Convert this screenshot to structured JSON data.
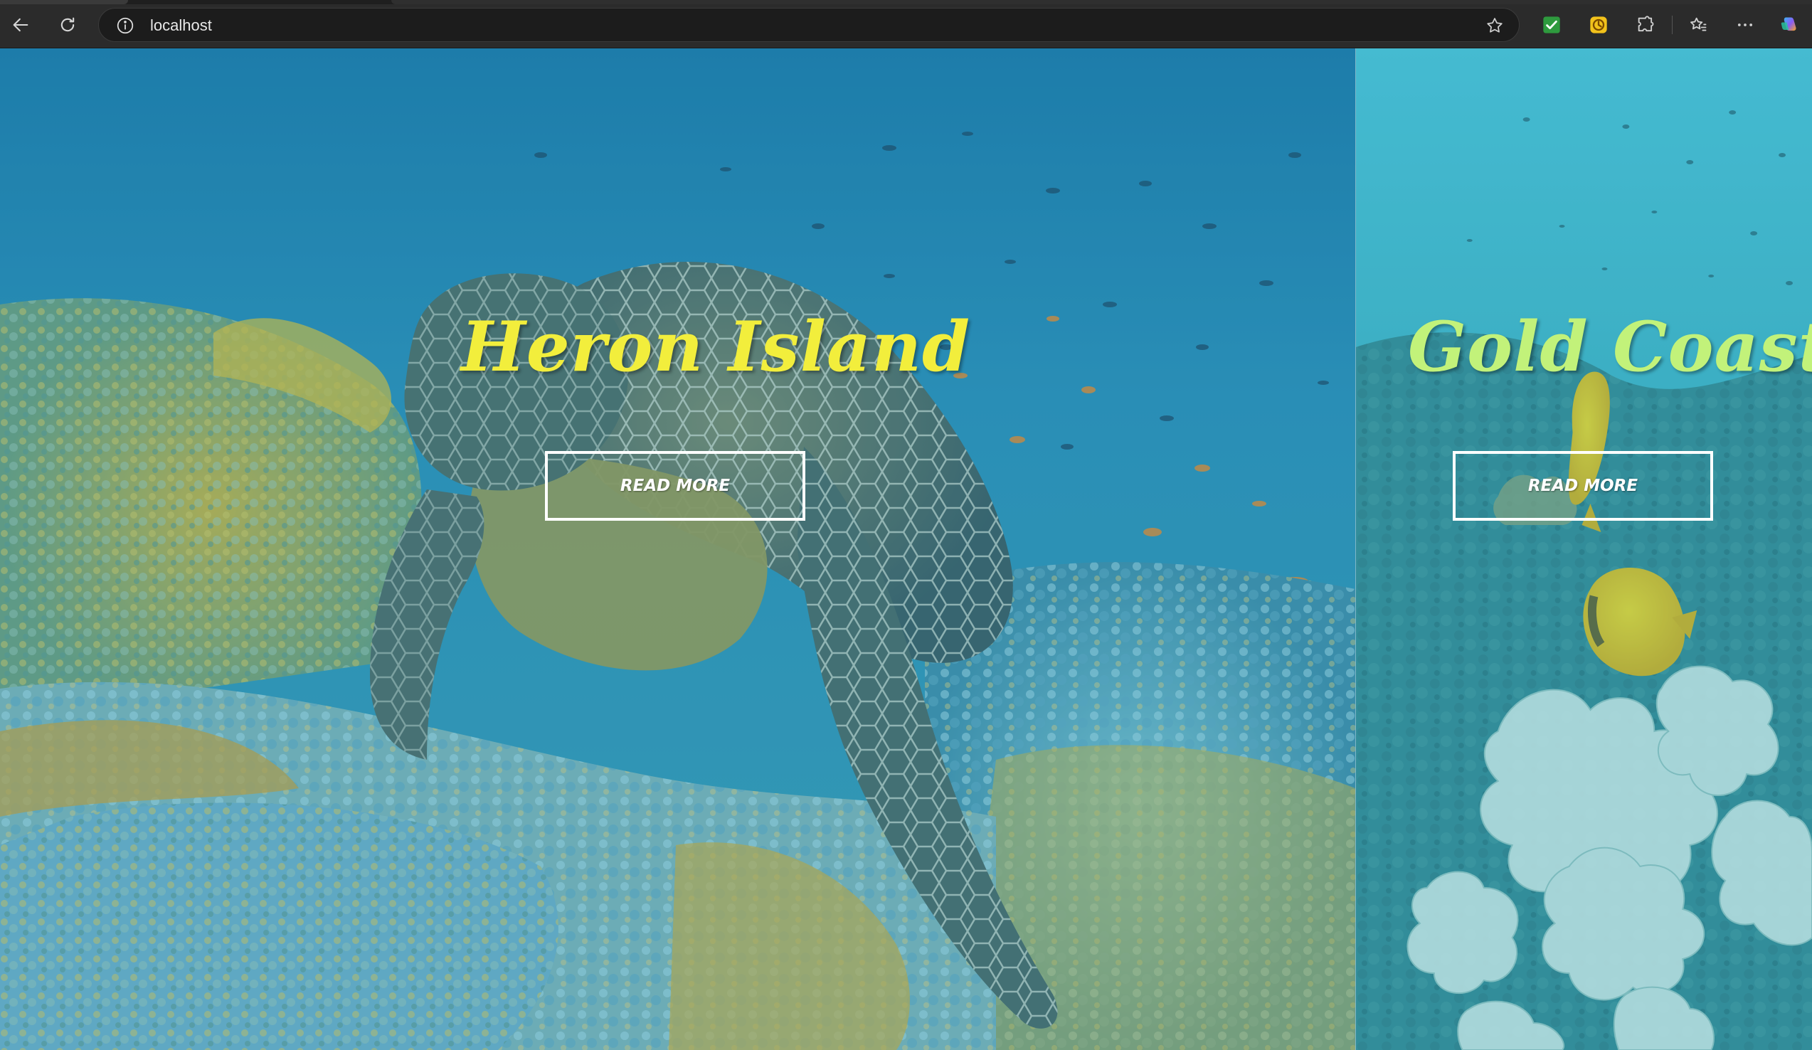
{
  "browser": {
    "url": "localhost",
    "icons": {
      "back": "back-arrow-icon",
      "reload": "reload-icon",
      "site_info": "info-icon",
      "bookmark": "star-icon",
      "extension_1": "checkmark-extension-icon",
      "extension_2": "coin-extension-icon",
      "extensions": "puzzle-icon",
      "favorites": "favorites-icon",
      "menu": "more-icon",
      "copilot": "copilot-icon"
    }
  },
  "panels": [
    {
      "title": "Heron Island",
      "button_label": "READ MORE",
      "title_color": "#f2ee3c",
      "scene": "sea turtle over coral reef"
    },
    {
      "title": "Gold Coast",
      "button_label": "READ MORE",
      "title_color": "#c2f27a",
      "scene": "butterflyfish over coral reef"
    }
  ],
  "colors": {
    "chrome": "#2b2b2b",
    "address_bar": "#1c1c1c",
    "overlay_heron": "#2a8fb0",
    "overlay_gold": "#3bb8c4"
  }
}
